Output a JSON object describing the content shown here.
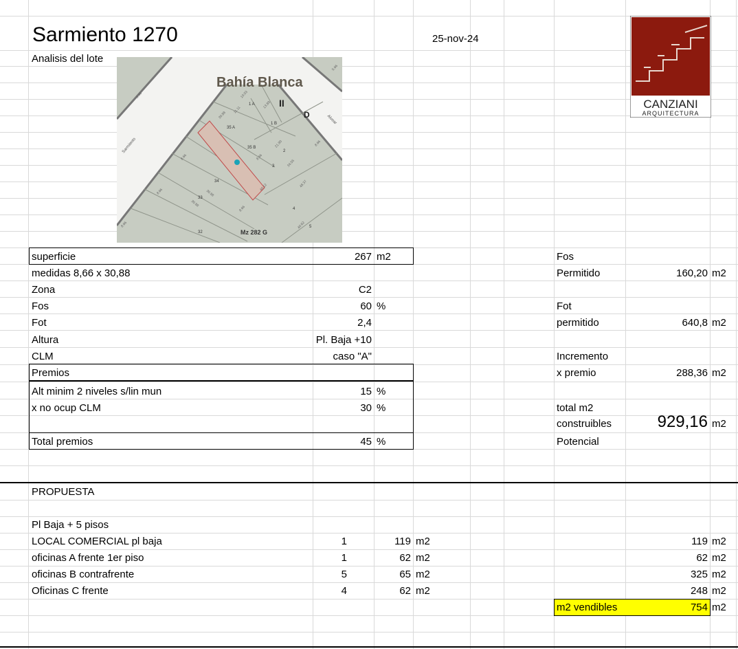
{
  "header": {
    "title": "Sarmiento 1270",
    "date": "25-nov-24",
    "subtitle": "Analisis del lote"
  },
  "map": {
    "city": "Bahía Blanca",
    "roman": "II",
    "zone_letter": "D",
    "street_left": "Sarmiento",
    "street_right": "Alvear",
    "block": "Mz 282 G",
    "lots": [
      "1 A",
      "1 B",
      "35 A",
      "35 B",
      "34",
      "33",
      "32",
      "2",
      "3",
      "4",
      "5"
    ],
    "dims": [
      "8.66",
      "30.88",
      "8.66",
      "30.88",
      "8.66",
      "30.88",
      "8.66",
      "8.66",
      "8.66",
      "8.66",
      "40.12",
      "48.37",
      "40.62",
      "34.55",
      "21.90",
      "10.03",
      "11.11",
      "13.89",
      "5.66"
    ]
  },
  "logo": {
    "name": "CANZIANI",
    "sub": "ARQUITECTURA",
    "bg_color": "#8c1a0e"
  },
  "lot": {
    "superficie": {
      "label": "superficie",
      "value": "267",
      "unit": "m2"
    },
    "medidas": "medidas 8,66 x 30,88",
    "zona": {
      "label": "Zona",
      "value": "C2"
    },
    "fos": {
      "label": "Fos",
      "value": "60",
      "unit": "%"
    },
    "fot": {
      "label": "Fot",
      "value": "2,4"
    },
    "altura": {
      "label": "Altura",
      "value": "Pl. Baja +10"
    },
    "clm": {
      "label": "CLM",
      "value": "caso \"A\""
    },
    "premios_label": "Premios",
    "premio1": {
      "label": "Alt minim 2 niveles s/lin mun",
      "value": "15",
      "unit": "%"
    },
    "premio2": {
      "label": "x no ocup CLM",
      "value": "30",
      "unit": "%"
    },
    "total": {
      "label": "Total premios",
      "value": "45",
      "unit": "%"
    }
  },
  "calc": {
    "fos_label": "Fos",
    "permitido_label": "Permitido",
    "permitido_value": "160,20",
    "fot_label": "Fot",
    "fot_permitido_label": "permitido",
    "fot_permitido_value": "640,8",
    "incremento_label": "Incremento",
    "xpremio_label": "x premio",
    "xpremio_value": "288,36",
    "total_label": "total m2",
    "construibles_label": "construibles",
    "construibles_value": "929,16",
    "potencial_label": "Potencial",
    "unit": "m2"
  },
  "propuesta": {
    "title": "PROPUESTA",
    "subtitle": "Pl Baja + 5 pisos",
    "unit": "m2",
    "rows": [
      {
        "label": "LOCAL COMERCIAL pl baja",
        "qty": "1",
        "area": "119",
        "total": "119"
      },
      {
        "label": "oficinas A frente 1er piso",
        "qty": "1",
        "area": "62",
        "total": "62"
      },
      {
        "label": "oficinas B contrafrente",
        "qty": "5",
        "area": "65",
        "total": "325"
      },
      {
        "label": "Oficinas C frente",
        "qty": "4",
        "area": "62",
        "total": "248"
      }
    ],
    "vendibles_label": "m2 vendibles",
    "vendibles_value": "754",
    "highlight_color": "#ffff00"
  }
}
